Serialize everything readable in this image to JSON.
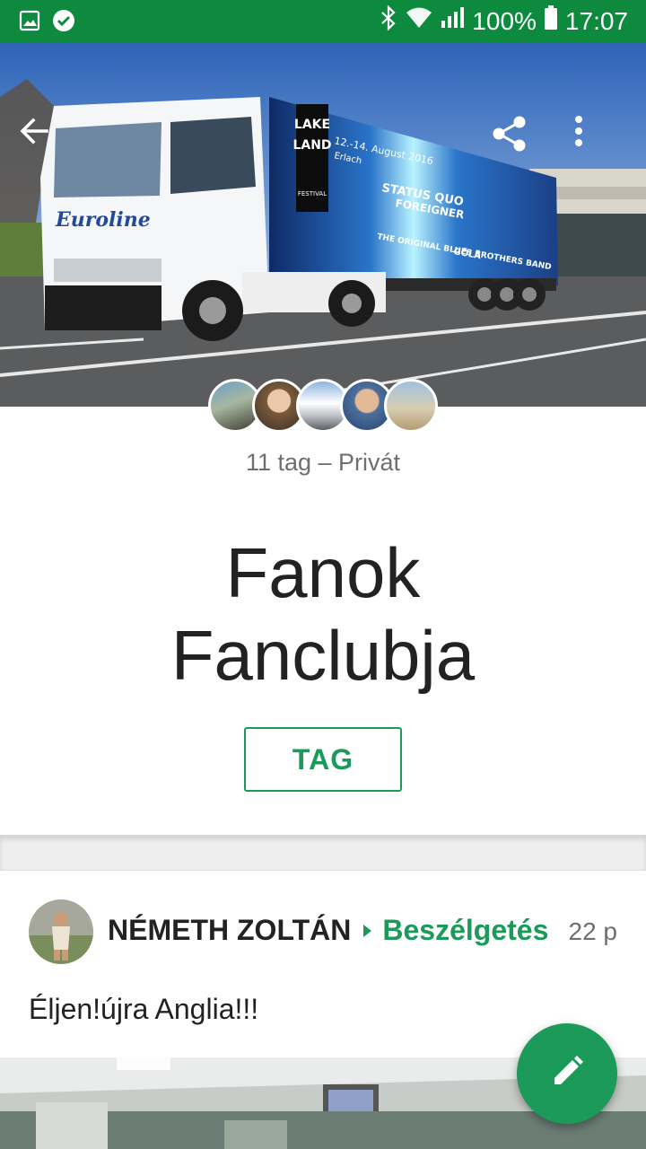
{
  "status_bar": {
    "battery": "100%",
    "time": "17:07",
    "left_icons": [
      "gallery-icon",
      "check-circle-icon"
    ],
    "right_icons": [
      "bluetooth-icon",
      "wifi-icon",
      "signal-icon",
      "battery-icon"
    ]
  },
  "header": {
    "back_icon": "arrow-back-icon",
    "share_icon": "share-icon",
    "menu_icon": "more-vert-icon",
    "cover_texts": {
      "brand": "Euroline",
      "festival_line1": "LAKE",
      "festival_line2": "LAND",
      "festival_line3": "FESTIVAL",
      "date": "12.-14. August 2016",
      "place": "Erlach",
      "band1": "STATUS QUO",
      "band2": "FOREIGNER",
      "band3": "THE ORIGINAL BLUES BROTHERS BAND",
      "band4": "GÖLÄ"
    }
  },
  "group": {
    "meta": "11 tag – Privát",
    "title_line1": "Fanok",
    "title_line2": "Fanclubja",
    "join_label": "TAG"
  },
  "post": {
    "author": "NÉMETH ZOLTÁN",
    "channel": "Beszélgetés",
    "time": "22 p",
    "text": "Éljen!újra Anglia!!!"
  },
  "fab": {
    "icon": "edit-pencil-icon"
  },
  "colors": {
    "status_bar": "#0e8a3f",
    "accent": "#1b9a59",
    "text": "#222222",
    "muted": "#6f6f6f"
  }
}
